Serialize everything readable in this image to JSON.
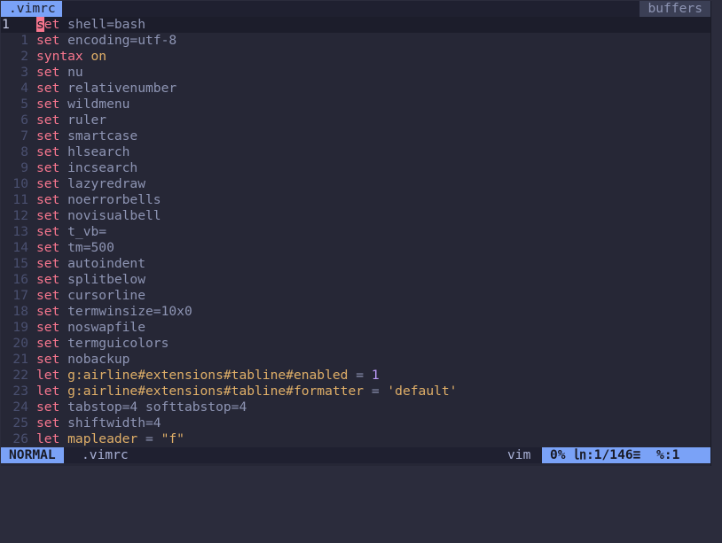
{
  "tabline": {
    "active_tab": ".vimrc",
    "buffers_label": "buffers"
  },
  "editor": {
    "lines": [
      {
        "num": "1",
        "current": true,
        "tokens": [
          {
            "t": "s",
            "c": "cursor"
          },
          {
            "t": "et",
            "c": "kw"
          },
          {
            "t": " ",
            "c": ""
          },
          {
            "t": "shell",
            "c": "opt"
          },
          {
            "t": "=bash",
            "c": "val"
          }
        ]
      },
      {
        "num": "1",
        "tokens": [
          {
            "t": "set",
            "c": "kw"
          },
          {
            "t": " encoding=utf-8",
            "c": "opt"
          }
        ]
      },
      {
        "num": "2",
        "tokens": [
          {
            "t": "syntax",
            "c": "kw"
          },
          {
            "t": " ",
            "c": ""
          },
          {
            "t": "on",
            "c": "on"
          }
        ]
      },
      {
        "num": "3",
        "tokens": [
          {
            "t": "set",
            "c": "kw"
          },
          {
            "t": " nu",
            "c": "opt"
          }
        ]
      },
      {
        "num": "4",
        "tokens": [
          {
            "t": "set",
            "c": "kw"
          },
          {
            "t": " relativenumber",
            "c": "opt"
          }
        ]
      },
      {
        "num": "5",
        "tokens": [
          {
            "t": "set",
            "c": "kw"
          },
          {
            "t": " wildmenu",
            "c": "opt"
          }
        ]
      },
      {
        "num": "6",
        "tokens": [
          {
            "t": "set",
            "c": "kw"
          },
          {
            "t": " ruler",
            "c": "opt"
          }
        ]
      },
      {
        "num": "7",
        "tokens": [
          {
            "t": "set",
            "c": "kw"
          },
          {
            "t": " smartcase",
            "c": "opt"
          }
        ]
      },
      {
        "num": "8",
        "tokens": [
          {
            "t": "set",
            "c": "kw"
          },
          {
            "t": " hlsearch",
            "c": "opt"
          }
        ]
      },
      {
        "num": "9",
        "tokens": [
          {
            "t": "set",
            "c": "kw"
          },
          {
            "t": " incsearch",
            "c": "opt"
          }
        ]
      },
      {
        "num": "10",
        "tokens": [
          {
            "t": "set",
            "c": "kw"
          },
          {
            "t": " lazyredraw",
            "c": "opt"
          }
        ]
      },
      {
        "num": "11",
        "tokens": [
          {
            "t": "set",
            "c": "kw"
          },
          {
            "t": " noerrorbells",
            "c": "opt"
          }
        ]
      },
      {
        "num": "12",
        "tokens": [
          {
            "t": "set",
            "c": "kw"
          },
          {
            "t": " novisualbell",
            "c": "opt"
          }
        ]
      },
      {
        "num": "13",
        "tokens": [
          {
            "t": "set",
            "c": "kw"
          },
          {
            "t": " t_vb=",
            "c": "opt"
          }
        ]
      },
      {
        "num": "14",
        "tokens": [
          {
            "t": "set",
            "c": "kw"
          },
          {
            "t": " tm=500",
            "c": "opt"
          }
        ]
      },
      {
        "num": "15",
        "tokens": [
          {
            "t": "set",
            "c": "kw"
          },
          {
            "t": " autoindent",
            "c": "opt"
          }
        ]
      },
      {
        "num": "16",
        "tokens": [
          {
            "t": "set",
            "c": "kw"
          },
          {
            "t": " splitbelow",
            "c": "opt"
          }
        ]
      },
      {
        "num": "17",
        "tokens": [
          {
            "t": "set",
            "c": "kw"
          },
          {
            "t": " cursorline",
            "c": "opt"
          }
        ]
      },
      {
        "num": "18",
        "tokens": [
          {
            "t": "set",
            "c": "kw"
          },
          {
            "t": " termwinsize=10x0",
            "c": "opt"
          }
        ]
      },
      {
        "num": "19",
        "tokens": [
          {
            "t": "set",
            "c": "kw"
          },
          {
            "t": " noswapfile",
            "c": "opt"
          }
        ]
      },
      {
        "num": "20",
        "tokens": [
          {
            "t": "set",
            "c": "kw"
          },
          {
            "t": " termguicolors",
            "c": "opt"
          }
        ]
      },
      {
        "num": "21",
        "tokens": [
          {
            "t": "set",
            "c": "kw"
          },
          {
            "t": " nobackup",
            "c": "opt"
          }
        ]
      },
      {
        "num": "22",
        "tokens": [
          {
            "t": "let",
            "c": "kw"
          },
          {
            "t": " g:airline#extensions#tabline#enabled",
            "c": "var"
          },
          {
            "t": " = ",
            "c": "opt"
          },
          {
            "t": "1",
            "c": "num"
          }
        ]
      },
      {
        "num": "23",
        "tokens": [
          {
            "t": "let",
            "c": "kw"
          },
          {
            "t": " g:airline#extensions#tabline#formatter",
            "c": "var"
          },
          {
            "t": " = ",
            "c": "opt"
          },
          {
            "t": "'default'",
            "c": "str"
          }
        ]
      },
      {
        "num": "24",
        "tokens": [
          {
            "t": "set",
            "c": "kw"
          },
          {
            "t": " tabstop=4 softtabstop=4",
            "c": "opt"
          }
        ]
      },
      {
        "num": "25",
        "tokens": [
          {
            "t": "set",
            "c": "kw"
          },
          {
            "t": " shiftwidth=4",
            "c": "opt"
          }
        ]
      },
      {
        "num": "26",
        "tokens": [
          {
            "t": "let",
            "c": "kw"
          },
          {
            "t": " mapleader",
            "c": "var"
          },
          {
            "t": " = ",
            "c": "opt"
          },
          {
            "t": "\"f\"",
            "c": "str"
          }
        ]
      }
    ]
  },
  "statusline": {
    "mode": "NORMAL",
    "filename": ".vimrc",
    "filetype": "vim",
    "position": "0% ㏑:1/146≡  %:1"
  },
  "colors": {
    "accent": "#7aa2f7",
    "keyword": "#f7768e",
    "background": "#262736"
  }
}
